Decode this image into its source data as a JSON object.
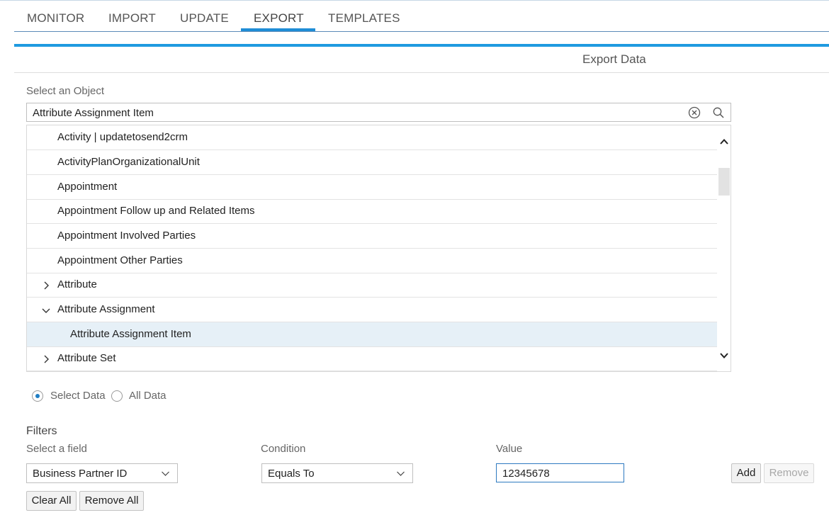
{
  "tabs": [
    {
      "label": "MONITOR"
    },
    {
      "label": "IMPORT"
    },
    {
      "label": "UPDATE"
    },
    {
      "label": "EXPORT",
      "active": true
    },
    {
      "label": "TEMPLATES"
    }
  ],
  "page_title": "Export Data",
  "object_selector": {
    "label": "Select an Object",
    "search_value": "Attribute Assignment Item"
  },
  "object_list": [
    {
      "label": "Activity | updatetosend2crm"
    },
    {
      "label": "ActivityPlanOrganizationalUnit"
    },
    {
      "label": "Appointment"
    },
    {
      "label": "Appointment Follow up and Related Items"
    },
    {
      "label": "Appointment Involved Parties"
    },
    {
      "label": "Appointment Other Parties"
    },
    {
      "label": "Attribute",
      "expander": "collapsed"
    },
    {
      "label": "Attribute Assignment",
      "expander": "expanded"
    },
    {
      "label": "Attribute Assignment Item",
      "selected": true
    },
    {
      "label": "Attribute Set",
      "expander": "collapsed"
    }
  ],
  "data_mode": {
    "options": [
      {
        "label": "Select Data",
        "selected": true
      },
      {
        "label": "All Data",
        "selected": false
      }
    ]
  },
  "filters": {
    "title": "Filters",
    "field_label": "Select a field",
    "field_value": "Business Partner ID",
    "condition_label": "Condition",
    "condition_value": "Equals To",
    "value_label": "Value",
    "value": "12345678",
    "add_label": "Add",
    "remove_label": "Remove",
    "clear_all_label": "Clear All",
    "remove_all_label": "Remove All"
  },
  "colors": {
    "accent": "#1f8dd6",
    "selected_row": "#e6f0f7"
  },
  "icons": {
    "clear": "circle-x-icon",
    "search": "search-icon",
    "expand": "chevron-right-icon",
    "collapse": "chevron-down-icon",
    "scroll_up": "chevron-up-icon",
    "scroll_down": "chevron-down-icon",
    "dropdown": "chevron-down-icon"
  }
}
